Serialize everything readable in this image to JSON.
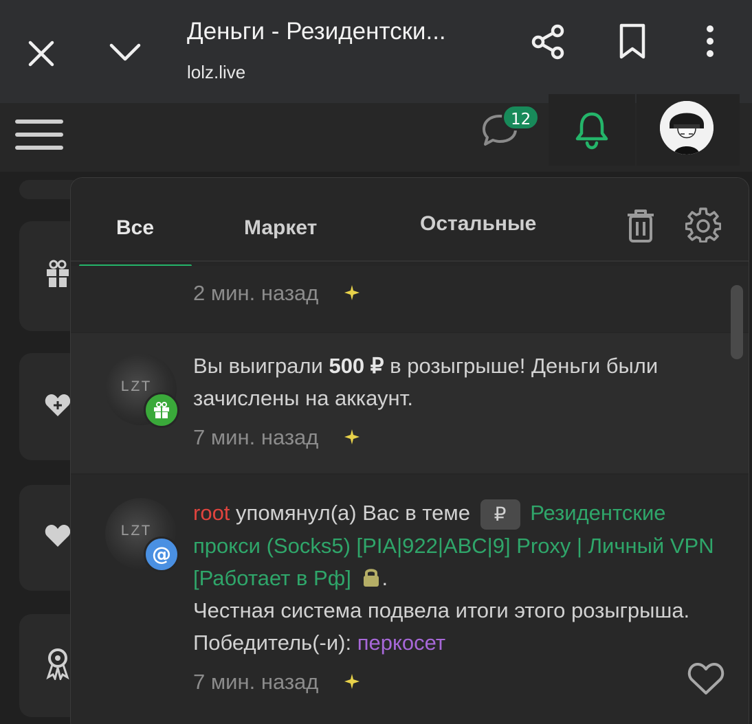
{
  "browser": {
    "title": "Деньги - Резидентски...",
    "url": "lolz.live"
  },
  "header": {
    "messages_count": "12"
  },
  "tabs": [
    {
      "label": "Все",
      "active": true
    },
    {
      "label": "Маркет",
      "active": false
    },
    {
      "label": "Остальные",
      "active": false
    }
  ],
  "notifications": [
    {
      "time": "2 мин. назад"
    },
    {
      "text_before": "Вы выиграли ",
      "amount": "500 ₽",
      "text_after": " в розыгрыше! Деньги были зачислены на аккаунт.",
      "time": "7 мин. назад",
      "avatar_text": "LZT"
    },
    {
      "username": "root",
      "mention_text": " упомянул(а) Вас в теме ",
      "currency_chip": "₽",
      "thread_title": "Резидентские прокси (Socks5) [PIA|922|ABC|9] Proxy | Личный VPN [Работает в Рф]",
      "period": ".",
      "body_text": "Честная система подвела итоги этого розыгрыша. Победитель(-и): ",
      "winner": "перкосет",
      "time": "7 мин. назад",
      "avatar_text": "LZT"
    }
  ],
  "colors": {
    "accent_green": "#24b56a",
    "username_red": "#e0443e",
    "winner_purple": "#a768d8",
    "gift_badge": "#3aa93a",
    "mention_badge": "#4a90e2"
  }
}
